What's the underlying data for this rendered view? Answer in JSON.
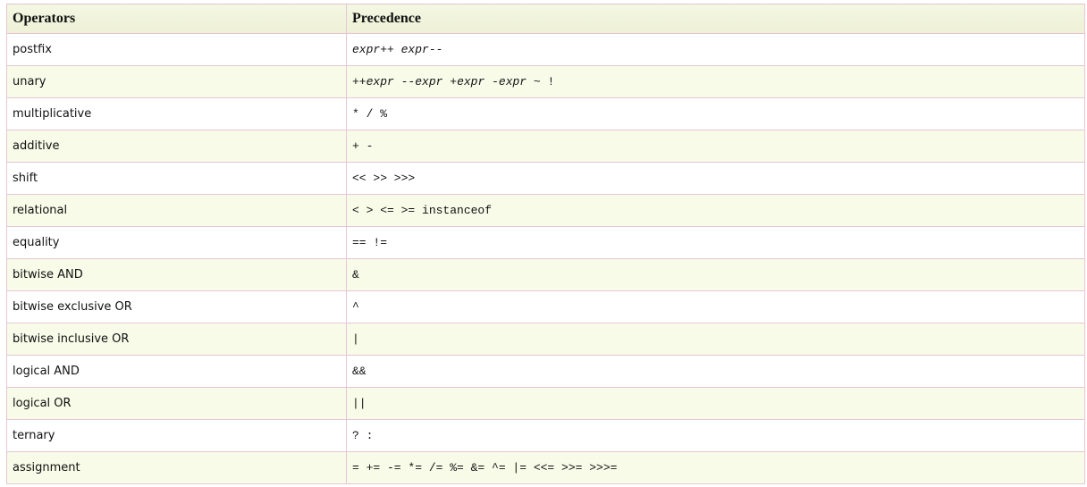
{
  "table": {
    "headers": [
      "Operators",
      "Precedence"
    ],
    "rows": [
      {
        "operator": "postfix",
        "precedence_html": "<i>expr</i>++ <i>expr</i>--"
      },
      {
        "operator": "unary",
        "precedence_html": "++<i>expr</i> --<i>expr</i> +<i>expr</i> -<i>expr</i> ~ !"
      },
      {
        "operator": "multiplicative",
        "precedence_html": "* / %"
      },
      {
        "operator": "additive",
        "precedence_html": "+ -"
      },
      {
        "operator": "shift",
        "precedence_html": "&lt;&lt; &gt;&gt; &gt;&gt;&gt;"
      },
      {
        "operator": "relational",
        "precedence_html": "&lt; &gt; &lt;= &gt;= instanceof"
      },
      {
        "operator": "equality",
        "precedence_html": "== !="
      },
      {
        "operator": "bitwise AND",
        "precedence_html": "&amp;"
      },
      {
        "operator": "bitwise exclusive OR",
        "precedence_html": "^"
      },
      {
        "operator": "bitwise inclusive OR",
        "precedence_html": "|"
      },
      {
        "operator": "logical AND",
        "precedence_html": "&amp;&amp;"
      },
      {
        "operator": "logical OR",
        "precedence_html": "||"
      },
      {
        "operator": "ternary",
        "precedence_html": "? :"
      },
      {
        "operator": "assignment",
        "precedence_html": "= += -= *= /= %= &amp;= ^= |= &lt;&lt;= &gt;&gt;= &gt;&gt;&gt;="
      }
    ]
  },
  "colors": {
    "border": "#e6c6d6",
    "header_bg": "#f4f7e2",
    "row_alt_bg": "#f7fbe8",
    "row_bg": "#ffffff"
  }
}
